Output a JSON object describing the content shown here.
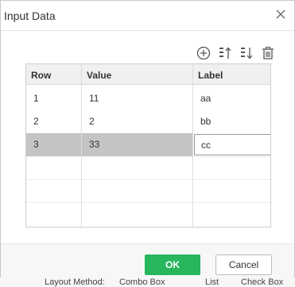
{
  "dialog": {
    "title": "Input Data",
    "toolbar": {
      "add_icon": "add-circle-icon",
      "move_up_icon": "move-up-icon",
      "move_down_icon": "move-down-icon",
      "delete_icon": "trash-icon"
    },
    "table": {
      "headers": [
        "Row",
        "Value",
        "Label"
      ],
      "rows": [
        {
          "row": "1",
          "value": "11",
          "label": "aa"
        },
        {
          "row": "2",
          "value": "2",
          "label": "bb"
        },
        {
          "row": "3",
          "value": "33",
          "label": "cc",
          "selected": true,
          "editing": true
        }
      ],
      "empty_rows": 3
    },
    "ok_label": "OK",
    "cancel_label": "Cancel",
    "accent_color": "#27b65c"
  },
  "background": {
    "layout_label": "Layout Method:",
    "option_combo": "Combo Box",
    "option_list": "List",
    "option_check": "Check Box"
  }
}
